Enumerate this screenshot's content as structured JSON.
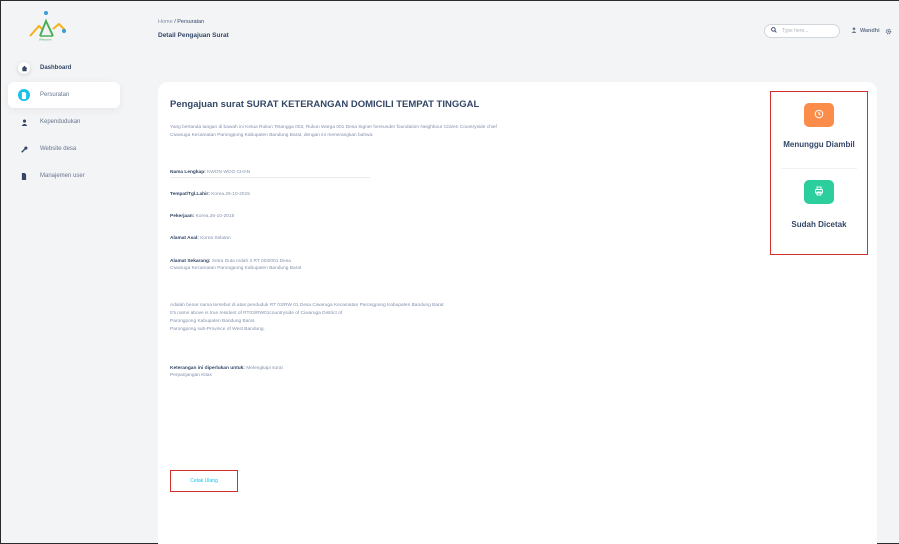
{
  "logo": {
    "text": "Welcome"
  },
  "sidebar": {
    "items": [
      {
        "label": "Dashboard",
        "icon": "home-icon"
      },
      {
        "label": "Persuratan",
        "icon": "document-icon"
      },
      {
        "label": "Kependudukan",
        "icon": "person-icon"
      },
      {
        "label": "Website desa",
        "icon": "wrench-icon"
      },
      {
        "label": "Manajemen user",
        "icon": "document-icon"
      }
    ]
  },
  "header": {
    "breadcrumb_home": "Home",
    "breadcrumb_sep": " / ",
    "breadcrumb_current": "Persuratan",
    "title": "Detail Pengajuan Surat",
    "search_placeholder": "Type here...",
    "user_name": "Wandhi"
  },
  "letter": {
    "heading": "Pengajuan surat SURAT KETERANGAN DOMICILI TEMPAT TINGGAL",
    "intro_1": "Yang bertanda tangan di bawah ini Ketua Rukun Tetangga 003, Rukun Warga 001 Desa Signer hereunder foundation Neighbour Citizen Countryside chief",
    "intro_2": "Ciwaruga Kecamatan Parongpong Kabupaten Bandung Barat, dengan ini menerangkan bahwa:",
    "nama_label": "Nama Lengkap:",
    "nama_value": "KWON WOO CHAN",
    "ttl_label": "Tempat/Tgl.Lahir:",
    "ttl_value": "Korea,26-10-2015",
    "pekerjaan_label": "Pekerjaan:",
    "pekerjaan_value": "Korea,26-10-2015",
    "asal_label": "Alamat Asal:",
    "asal_value": "Korea Selatan",
    "sekarang_label": "Alamat Sekarang:",
    "sekarang_value_1": "Setra Duta Indah 3 RT 003/001 Desa",
    "sekarang_value_2": "Ciwaruga Kecamatan Parongpong Kabupaten Bandung Barat",
    "body_1": "Adalah benar nama tersebut di atas penduduk RT 03/RW 01 Desa Ciwaruga Kecamatan Parongpong Kabupaten Bandung Barat",
    "body_2": "It's name above is true resident of RT03/RW01countryside of Ciwaruga District of",
    "body_3": "Parongpong Kabupaten Bandung Barat.",
    "body_4": "Parongpong sub-Province of West Bandung.",
    "purpose_label": "Keterangan ini diperlukan untuk:",
    "purpose_value_1": "Melengkapi surat",
    "purpose_value_2": "Perpanjangan Kitas",
    "cetak_label": "Cetak Ulang"
  },
  "status": {
    "waiting_label": "Menunggu Diambil",
    "printed_label": "Sudah Dicetak",
    "waiting_color": "#fb8c4a",
    "printed_color": "#2dce9d"
  }
}
